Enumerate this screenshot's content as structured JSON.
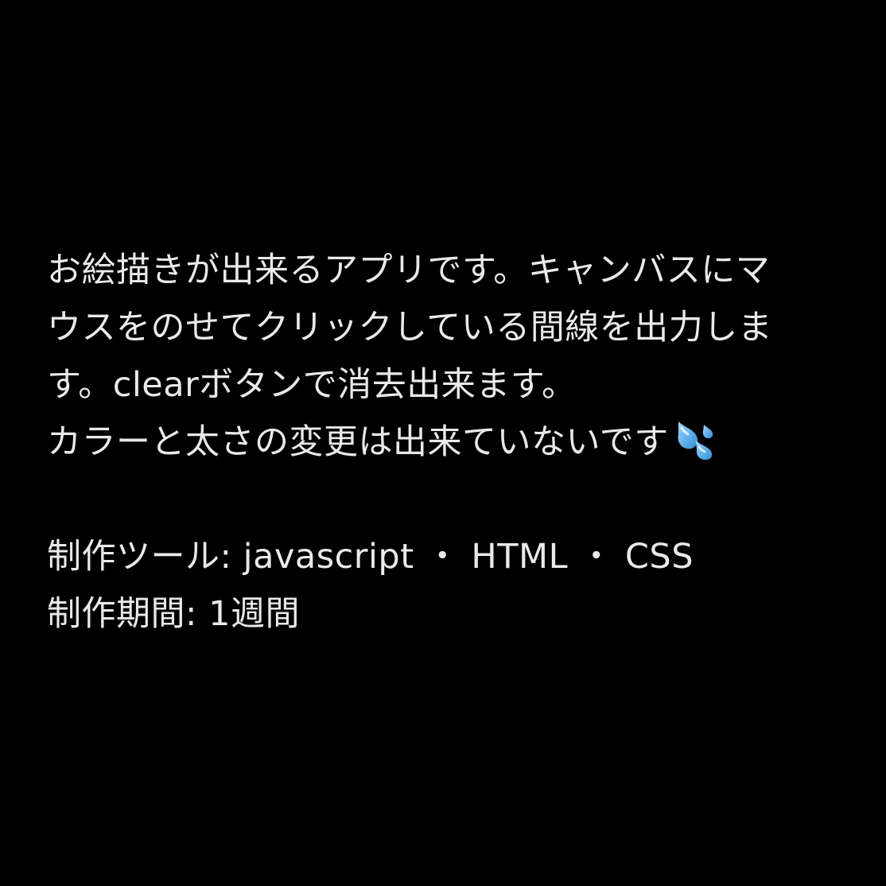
{
  "description_lines": [
    "お絵描きが出来るアプリです。キャンバスにマ",
    "ウスをのせてクリックしている間線を出力しま",
    "す。clearボタンで消去出来ます。"
  ],
  "note_line": "カラーと太さの変更は出来ていないです",
  "note_icon": "sweat-droplets-icon",
  "tools_line": "制作ツール: javascript ・ HTML ・ CSS",
  "period_line": "制作期間: 1週間",
  "colors": {
    "background": "#000000",
    "text": "#e9e9e9",
    "emoji_blue": "#4aa6e8"
  }
}
